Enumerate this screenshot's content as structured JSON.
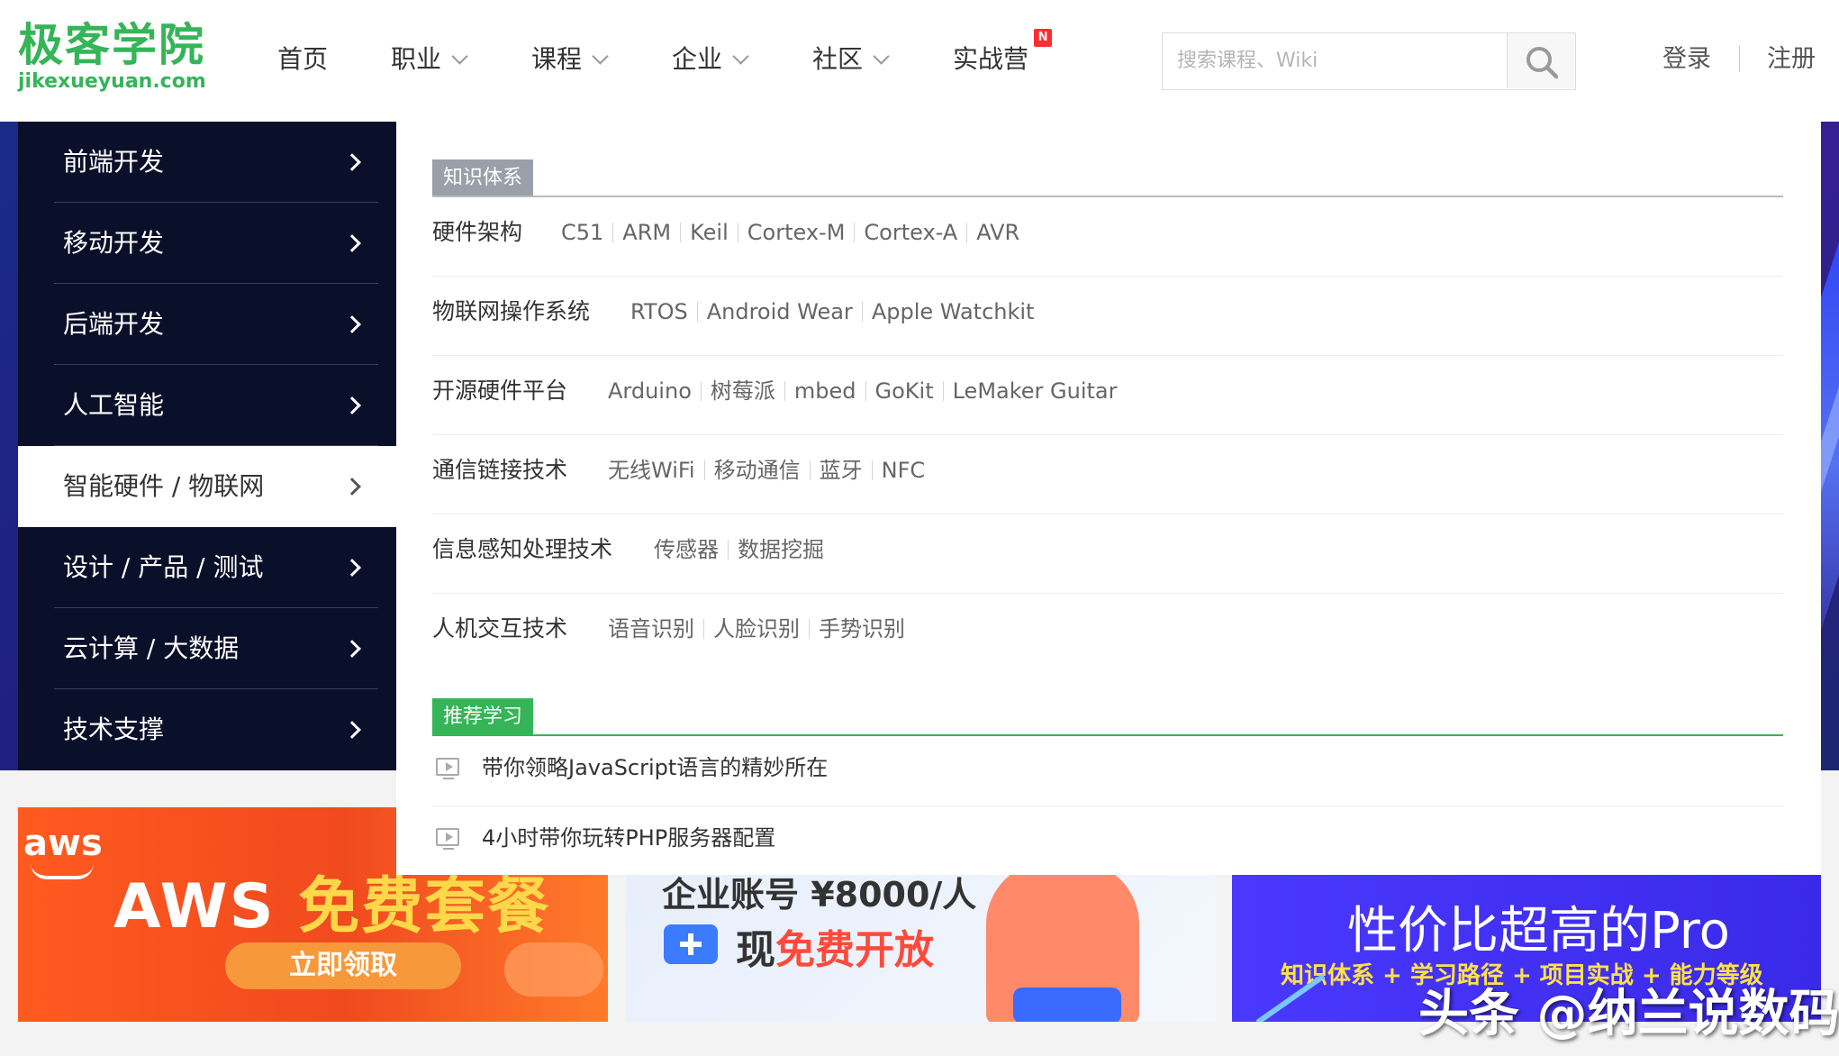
{
  "logo": {
    "cn": "极客学院",
    "en": "jikexueyuan.com"
  },
  "nav": {
    "items": [
      {
        "label": "首页",
        "dropdown": false
      },
      {
        "label": "职业",
        "dropdown": true
      },
      {
        "label": "课程",
        "dropdown": true
      },
      {
        "label": "企业",
        "dropdown": true
      },
      {
        "label": "社区",
        "dropdown": true
      },
      {
        "label": "实战营",
        "dropdown": false,
        "badge": "N"
      }
    ]
  },
  "search": {
    "placeholder": "搜索课程、Wiki",
    "value": ""
  },
  "auth": {
    "login": "登录",
    "register": "注册"
  },
  "sidebar": {
    "items": [
      {
        "label": "前端开发"
      },
      {
        "label": "移动开发"
      },
      {
        "label": "后端开发"
      },
      {
        "label": "人工智能"
      },
      {
        "label": "智能硬件 / 物联网",
        "active": true
      },
      {
        "label": "设计 / 产品 / 测试"
      },
      {
        "label": "云计算 / 大数据"
      },
      {
        "label": "技术支撑"
      }
    ]
  },
  "panel": {
    "knowledge_title": "知识体系",
    "knowledge": [
      {
        "category": "硬件架构",
        "links": [
          "C51",
          "ARM",
          "Keil",
          "Cortex-M",
          "Cortex-A",
          "AVR"
        ]
      },
      {
        "category": "物联网操作系统",
        "links": [
          "RTOS",
          "Android Wear",
          "Apple Watchkit"
        ]
      },
      {
        "category": "开源硬件平台",
        "links": [
          "Arduino",
          "树莓派",
          "mbed",
          "GoKit",
          "LeMaker Guitar"
        ]
      },
      {
        "category": "通信链接技术",
        "links": [
          "无线WiFi",
          "移动通信",
          "蓝牙",
          "NFC"
        ]
      },
      {
        "category": "信息感知处理技术",
        "links": [
          "传感器",
          "数据挖掘"
        ]
      },
      {
        "category": "人机交互技术",
        "links": [
          "语音识别",
          "人脸识别",
          "手势识别"
        ]
      }
    ],
    "recommend_title": "推荐学习",
    "recommend": [
      {
        "title": "带你领略JavaScript语言的精妙所在"
      },
      {
        "title": "4小时带你玩转PHP服务器配置"
      }
    ]
  },
  "promos": {
    "aws": {
      "logo": "aws",
      "title_a": "AWS",
      "title_b": "免费套餐",
      "cta": "立即领取"
    },
    "biz": {
      "line1": "企业账号 ¥8000/人",
      "line2_a": "现",
      "line2_b": "免费开放"
    },
    "pro": {
      "title": "性价比超高的Pro",
      "subtitle": "知识体系 + 学习路径 + 项目实战 + 能力等级"
    }
  },
  "watermark": "头条 @纳兰说数码",
  "colors": {
    "brand_green": "#35b558",
    "sidebar_bg": "#0a0f2a",
    "badge_red": "#ff2d2d"
  }
}
